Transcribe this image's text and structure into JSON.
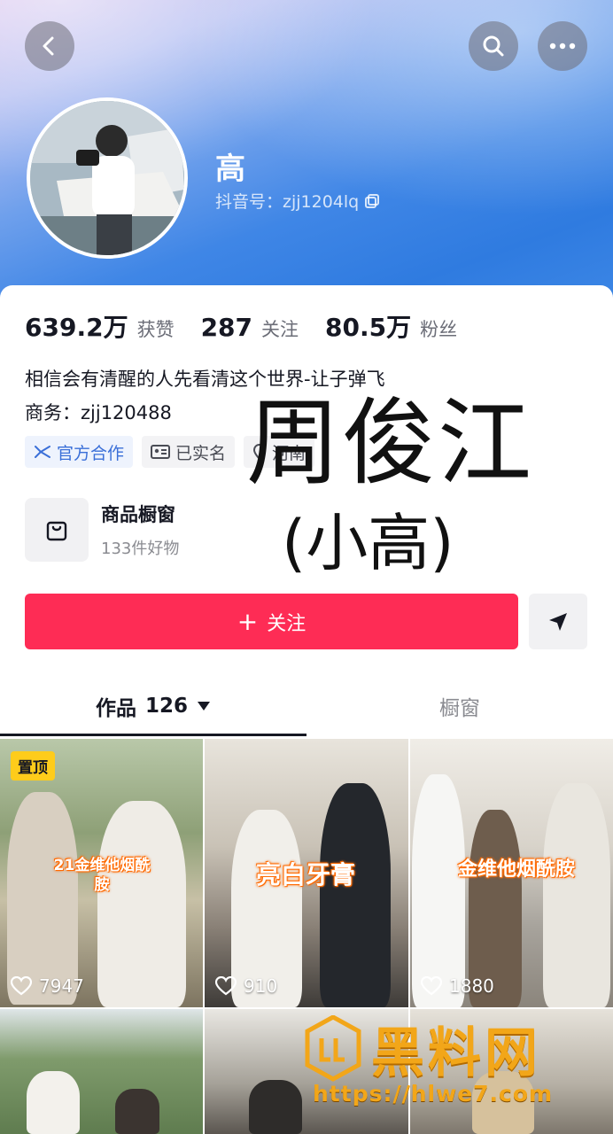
{
  "header": {
    "nickname": "高",
    "douyin_id": "抖音号：zjj1204lq"
  },
  "stats": [
    {
      "value": "639.2万",
      "label": "获赞"
    },
    {
      "value": "287",
      "label": "关注"
    },
    {
      "value": "80.5万",
      "label": "粉丝"
    }
  ],
  "bio": "相信会有清醒的人先看清这个世界-让子弹飞",
  "business": "商务：zjj120488",
  "tags": [
    "官方合作",
    "已实名",
    "河南"
  ],
  "shop": {
    "title": "商品橱窗",
    "subtitle": "133件好物"
  },
  "overlay": {
    "name": "周俊江",
    "sub": "(小高)"
  },
  "actions": {
    "follow_label": "关注",
    "follow_plus": "+"
  },
  "tabs": {
    "works_label": "作品",
    "works_count": "126",
    "window_label": "橱窗"
  },
  "videos": [
    {
      "pinned_label": "置顶",
      "caption": "21金维他烟酰胺",
      "likes": "7947"
    },
    {
      "caption": "亮白牙膏",
      "likes": "910"
    },
    {
      "caption": "金维他烟酰胺",
      "likes": "1880"
    }
  ],
  "watermark": {
    "brand": "黑料网",
    "url": "https://hlwe7.com"
  },
  "colors": {
    "follow_button": "#fe2c55",
    "pin_badge": "#fecc1b",
    "watermark": "#f2a619",
    "header_gradient_mid": "#3f86e6"
  },
  "icons": [
    "back-arrow-icon",
    "search-icon",
    "more-dots-icon",
    "copy-icon",
    "official-cooperation-icon",
    "id-card-icon",
    "location-icon",
    "shopping-bag-icon",
    "share-send-icon",
    "dropdown-triangle-icon",
    "heart-icon"
  ]
}
